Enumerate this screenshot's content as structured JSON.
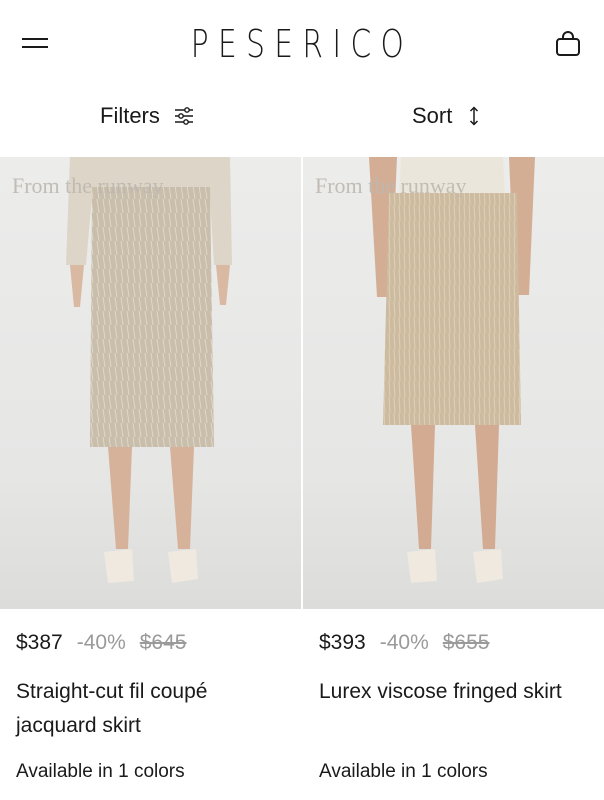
{
  "header": {
    "brand": "PESERICO",
    "menu_icon": "hamburger-menu-icon",
    "bag_icon": "shopping-bag-icon"
  },
  "toolbar": {
    "filters_label": "Filters",
    "filters_icon": "sliders-icon",
    "sort_label": "Sort",
    "sort_icon": "up-down-arrows-icon"
  },
  "products": [
    {
      "badge": "From the runway",
      "price": "$387",
      "discount": "-40%",
      "original_price": "$645",
      "name": "Straight-cut fil coupé jacquard skirt",
      "availability": "Available in 1 colors",
      "skirt_color": "#c9bdab"
    },
    {
      "badge": "From the runway",
      "price": "$393",
      "discount": "-40%",
      "original_price": "$655",
      "name": "Lurex viscose fringed skirt",
      "availability": "Available in 1 colors",
      "skirt_color": "#cdbb9f"
    }
  ],
  "colors": {
    "text": "#1a1a1a",
    "muted": "#9a9a9a",
    "background": "#ffffff"
  }
}
